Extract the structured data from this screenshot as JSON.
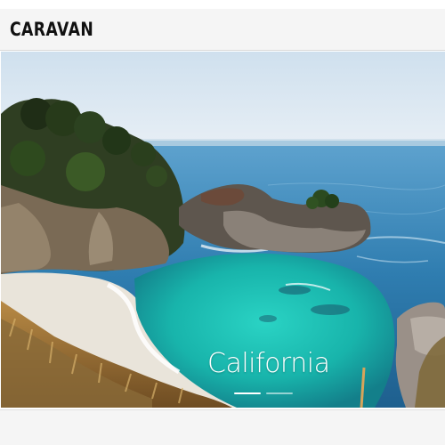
{
  "header": {
    "brand": "CARAVAN"
  },
  "hero": {
    "title": "California",
    "image_icon": "coastal-cove-photo",
    "slide_count": 2,
    "active_slide": 1
  },
  "colors": {
    "header_bg": "#f5f5f5",
    "sky": "#d7e6f2",
    "ocean": "#2f7fb0",
    "lagoon": "#1fb9b0",
    "title_text": "#ffffff"
  }
}
